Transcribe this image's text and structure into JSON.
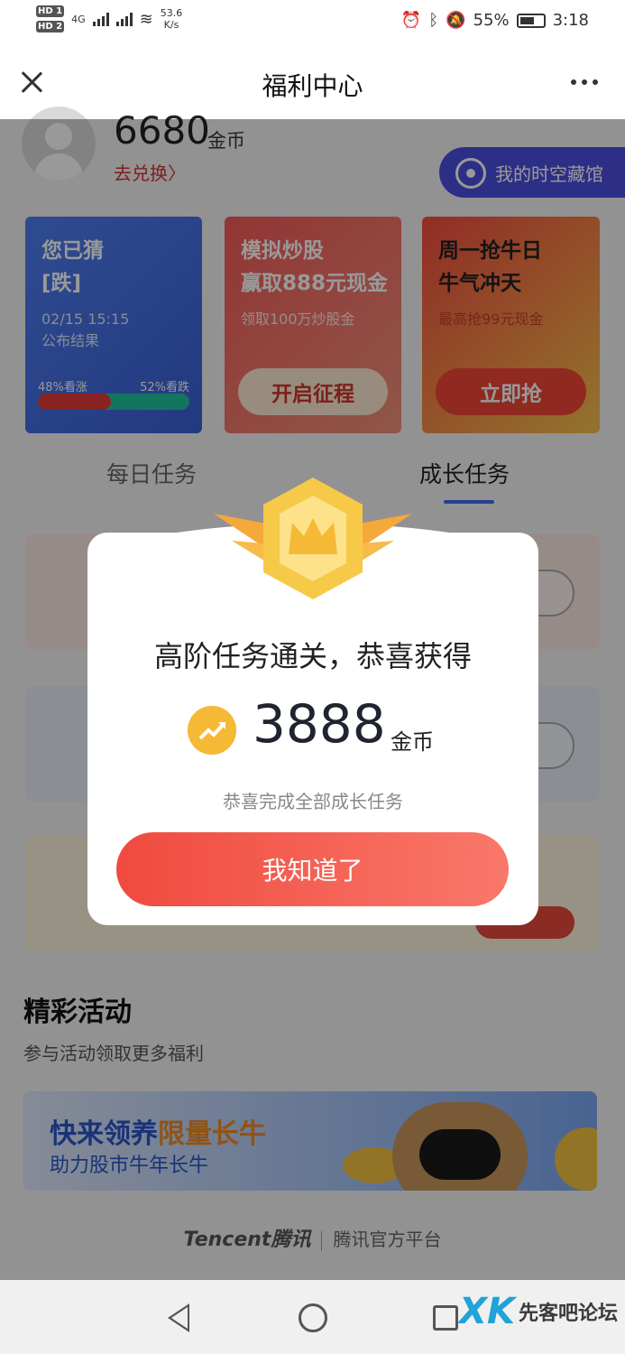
{
  "status_bar": {
    "sim1": "HD 1",
    "sim2": "HD 2",
    "net_type": "4G",
    "net_speed": "53.6",
    "net_unit": "K/s",
    "battery": "55%",
    "time": "3:18"
  },
  "title_bar": {
    "title": "福利中心"
  },
  "profile": {
    "coins": "6680",
    "coins_unit": "金币",
    "exchange_link": "去兑换",
    "museum_button": "我的时空藏馆"
  },
  "cards": {
    "guess": {
      "title_line1": "您已猜",
      "title_line2": "[跌]",
      "date": "02/15 15:15",
      "publish": "公布结果",
      "up_label": "48%看涨",
      "down_label": "52%看跌",
      "up_ratio": 0.48
    },
    "trade": {
      "title_line1": "模拟炒股",
      "title_line2": "赢取888元现金",
      "sub": "领取100万炒股金",
      "button": "开启征程"
    },
    "monday": {
      "title_line1": "周一抢牛日",
      "title_line2": "牛气冲天",
      "sub": "最高抢99元现金",
      "button": "立即抢"
    }
  },
  "tabs": {
    "daily": "每日任务",
    "growth": "成长任务"
  },
  "activities": {
    "title": "精彩活动",
    "subtitle": "参与活动领取更多福利",
    "banner_line1_a": "快来领养",
    "banner_line1_b": "限量长牛",
    "banner_line2": "助力股市牛年长牛"
  },
  "footer": {
    "brand": "Tencent腾讯",
    "platform": "腾讯官方平台"
  },
  "modal": {
    "title": "高阶任务通关，恭喜获得",
    "reward_amount": "3888",
    "reward_unit": "金币",
    "subtitle": "恭喜完成全部成长任务",
    "button": "我知道了"
  },
  "watermark": {
    "logo": "XK",
    "text": "先客吧论坛"
  },
  "colors": {
    "accent_red": "#f04a3f",
    "accent_blue": "#3b6ff0",
    "museum_purple": "#4b4fe0",
    "coin_gold": "#f6b935"
  },
  "icons": [
    "close-icon",
    "more-icon",
    "eye-icon",
    "trend-up-icon",
    "badge-icon",
    "back-icon",
    "home-icon",
    "recent-apps-icon"
  ]
}
